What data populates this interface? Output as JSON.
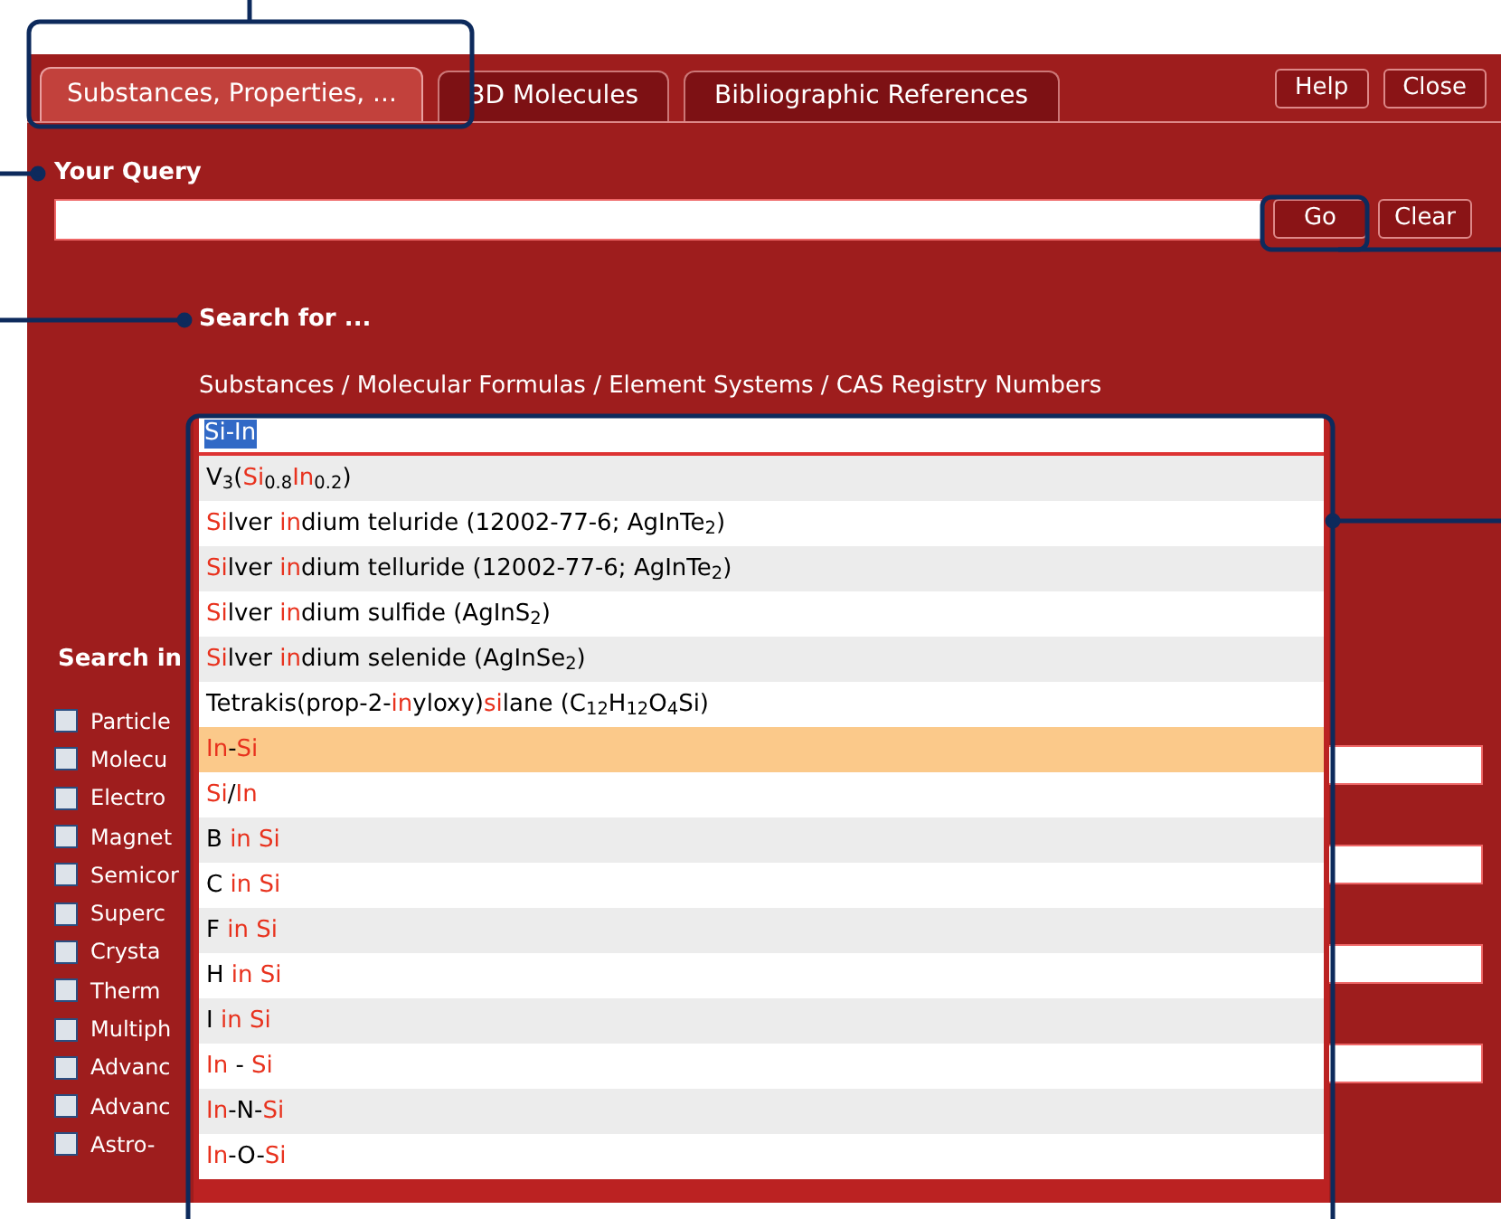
{
  "tabs": [
    {
      "label": "Substances, Properties, ...",
      "selected": true
    },
    {
      "label": "3D Molecules",
      "selected": false
    },
    {
      "label": "Bibliographic References",
      "selected": false
    }
  ],
  "header_buttons": [
    "Help",
    "Close"
  ],
  "query": {
    "label": "Your Query",
    "buttons": [
      "Go",
      "Clear"
    ]
  },
  "search_for": {
    "label": "Search for ...",
    "hint": "Substances / Molecular Formulas / Element Systems / CAS Registry Numbers",
    "value": "Si-In"
  },
  "suggestions": [
    [
      {
        "text": "V$_{3}$(",
        "match": false
      },
      {
        "text": "Si",
        "match": true
      },
      {
        "text": "$_{0.8}$",
        "match": false
      },
      {
        "text": "In",
        "match": true
      },
      {
        "text": "$_{0.2}$)",
        "match": false
      }
    ],
    [
      {
        "text": "Si",
        "match": true
      },
      {
        "text": "lver ",
        "match": false
      },
      {
        "text": "in",
        "match": true
      },
      {
        "text": "dium teluride (12002-77-6; AgInTe$_{2}$)",
        "match": false
      }
    ],
    [
      {
        "text": "Si",
        "match": true
      },
      {
        "text": "lver ",
        "match": false
      },
      {
        "text": "in",
        "match": true
      },
      {
        "text": "dium telluride (12002-77-6; AgInTe$_{2}$)",
        "match": false
      }
    ],
    [
      {
        "text": "Si",
        "match": true
      },
      {
        "text": "lver ",
        "match": false
      },
      {
        "text": "in",
        "match": true
      },
      {
        "text": "dium sulfide (AgInS$_{2}$)",
        "match": false
      }
    ],
    [
      {
        "text": "Si",
        "match": true
      },
      {
        "text": "lver ",
        "match": false
      },
      {
        "text": "in",
        "match": true
      },
      {
        "text": "dium selenide (AgInSe$_{2}$)",
        "match": false
      }
    ],
    [
      {
        "text": "Tetrakis(prop-2-",
        "match": false
      },
      {
        "text": "in",
        "match": true
      },
      {
        "text": "yloxy)",
        "match": false
      },
      {
        "text": "si",
        "match": true
      },
      {
        "text": "lane (C$_{12}$H$_{12}$O$_{4}$Si)",
        "match": false
      }
    ],
    [
      {
        "text": "In",
        "match": true
      },
      {
        "text": "-",
        "match": false
      },
      {
        "text": "Si",
        "match": true
      }
    ],
    [
      {
        "text": "Si",
        "match": true
      },
      {
        "text": "/",
        "match": false
      },
      {
        "text": "In",
        "match": true
      }
    ],
    [
      {
        "text": "B ",
        "match": false
      },
      {
        "text": "in Si",
        "match": true
      }
    ],
    [
      {
        "text": "C ",
        "match": false
      },
      {
        "text": "in Si",
        "match": true
      }
    ],
    [
      {
        "text": "F ",
        "match": false
      },
      {
        "text": "in Si",
        "match": true
      }
    ],
    [
      {
        "text": "H ",
        "match": false
      },
      {
        "text": "in Si",
        "match": true
      }
    ],
    [
      {
        "text": "I ",
        "match": false
      },
      {
        "text": "in Si",
        "match": true
      }
    ],
    [
      {
        "text": "In",
        "match": true
      },
      {
        "text": " - ",
        "match": false
      },
      {
        "text": "Si",
        "match": true
      }
    ],
    [
      {
        "text": "In",
        "match": true
      },
      {
        "text": "-N-",
        "match": false
      },
      {
        "text": "Si",
        "match": true
      }
    ],
    [
      {
        "text": "In",
        "match": true
      },
      {
        "text": "-O-",
        "match": false
      },
      {
        "text": "Si",
        "match": true
      }
    ]
  ],
  "suggestion_states": [
    false,
    false,
    false,
    false,
    false,
    false,
    true,
    false,
    false,
    false,
    false,
    false,
    false,
    false,
    false,
    false
  ],
  "search_in": {
    "label": "Search in",
    "options": [
      {
        "label": "Particle",
        "checked": false
      },
      {
        "label": "Molecu",
        "checked": false
      },
      {
        "label": "Electro",
        "checked": false
      },
      {
        "label": "Magnet",
        "checked": false
      },
      {
        "label": "Semicor",
        "checked": false
      },
      {
        "label": "Superc",
        "checked": false
      },
      {
        "label": "Crysta",
        "checked": false
      },
      {
        "label": "Therm",
        "checked": false
      },
      {
        "label": "Multiph",
        "checked": false
      },
      {
        "label": "Advanc",
        "checked": false
      },
      {
        "label": "Advanc",
        "checked": false
      },
      {
        "label": "Astro-",
        "checked": false
      }
    ]
  }
}
